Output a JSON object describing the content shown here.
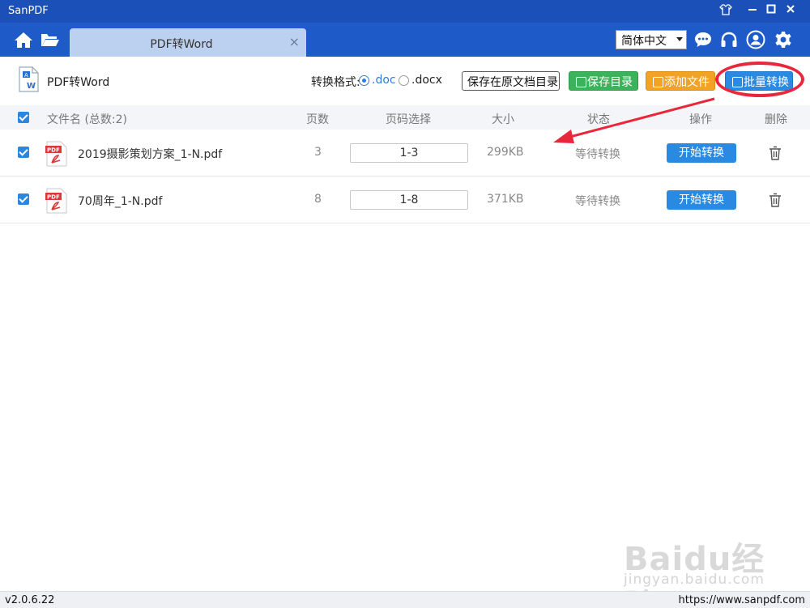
{
  "app": {
    "title": "SanPDF"
  },
  "navbar": {
    "tab_label": "PDF转Word",
    "tab_close": "×",
    "language": "简体中文"
  },
  "toolbar": {
    "title": "PDF转Word",
    "format_label": "转换格式:",
    "format_options": [
      ".doc",
      ".docx"
    ],
    "selected_format": ".doc",
    "save_original_label": "保存在原文档目录",
    "save_dir_label": "保存目录",
    "add_file_label": "添加文件",
    "batch_convert_label": "批量转换"
  },
  "table": {
    "headers": {
      "filename": "文件名 (总数:2)",
      "pages": "页数",
      "page_select": "页码选择",
      "size": "大小",
      "status": "状态",
      "action": "操作",
      "delete": "删除"
    },
    "rows": [
      {
        "filename": "2019摄影策划方案_1-N.pdf",
        "pages": "3",
        "page_range": "1-3",
        "size": "299KB",
        "status": "等待转换",
        "action": "开始转换",
        "checked": true
      },
      {
        "filename": "70周年_1-N.pdf",
        "pages": "8",
        "page_range": "1-8",
        "size": "371KB",
        "status": "等待转换",
        "action": "开始转换",
        "checked": true
      }
    ]
  },
  "statusbar": {
    "version": "v2.0.6.22",
    "url": "https://www.sanpdf.com"
  },
  "watermark": {
    "main": "Baidu经验",
    "sub": "jingyan.baidu.com"
  },
  "colors": {
    "titlebar": "#1a50b8",
    "navbar": "#1f5bc8",
    "accent_blue": "#2a8ae2",
    "green": "#3cb35a",
    "orange": "#f3a324",
    "annotation_red": "#e8273a"
  }
}
